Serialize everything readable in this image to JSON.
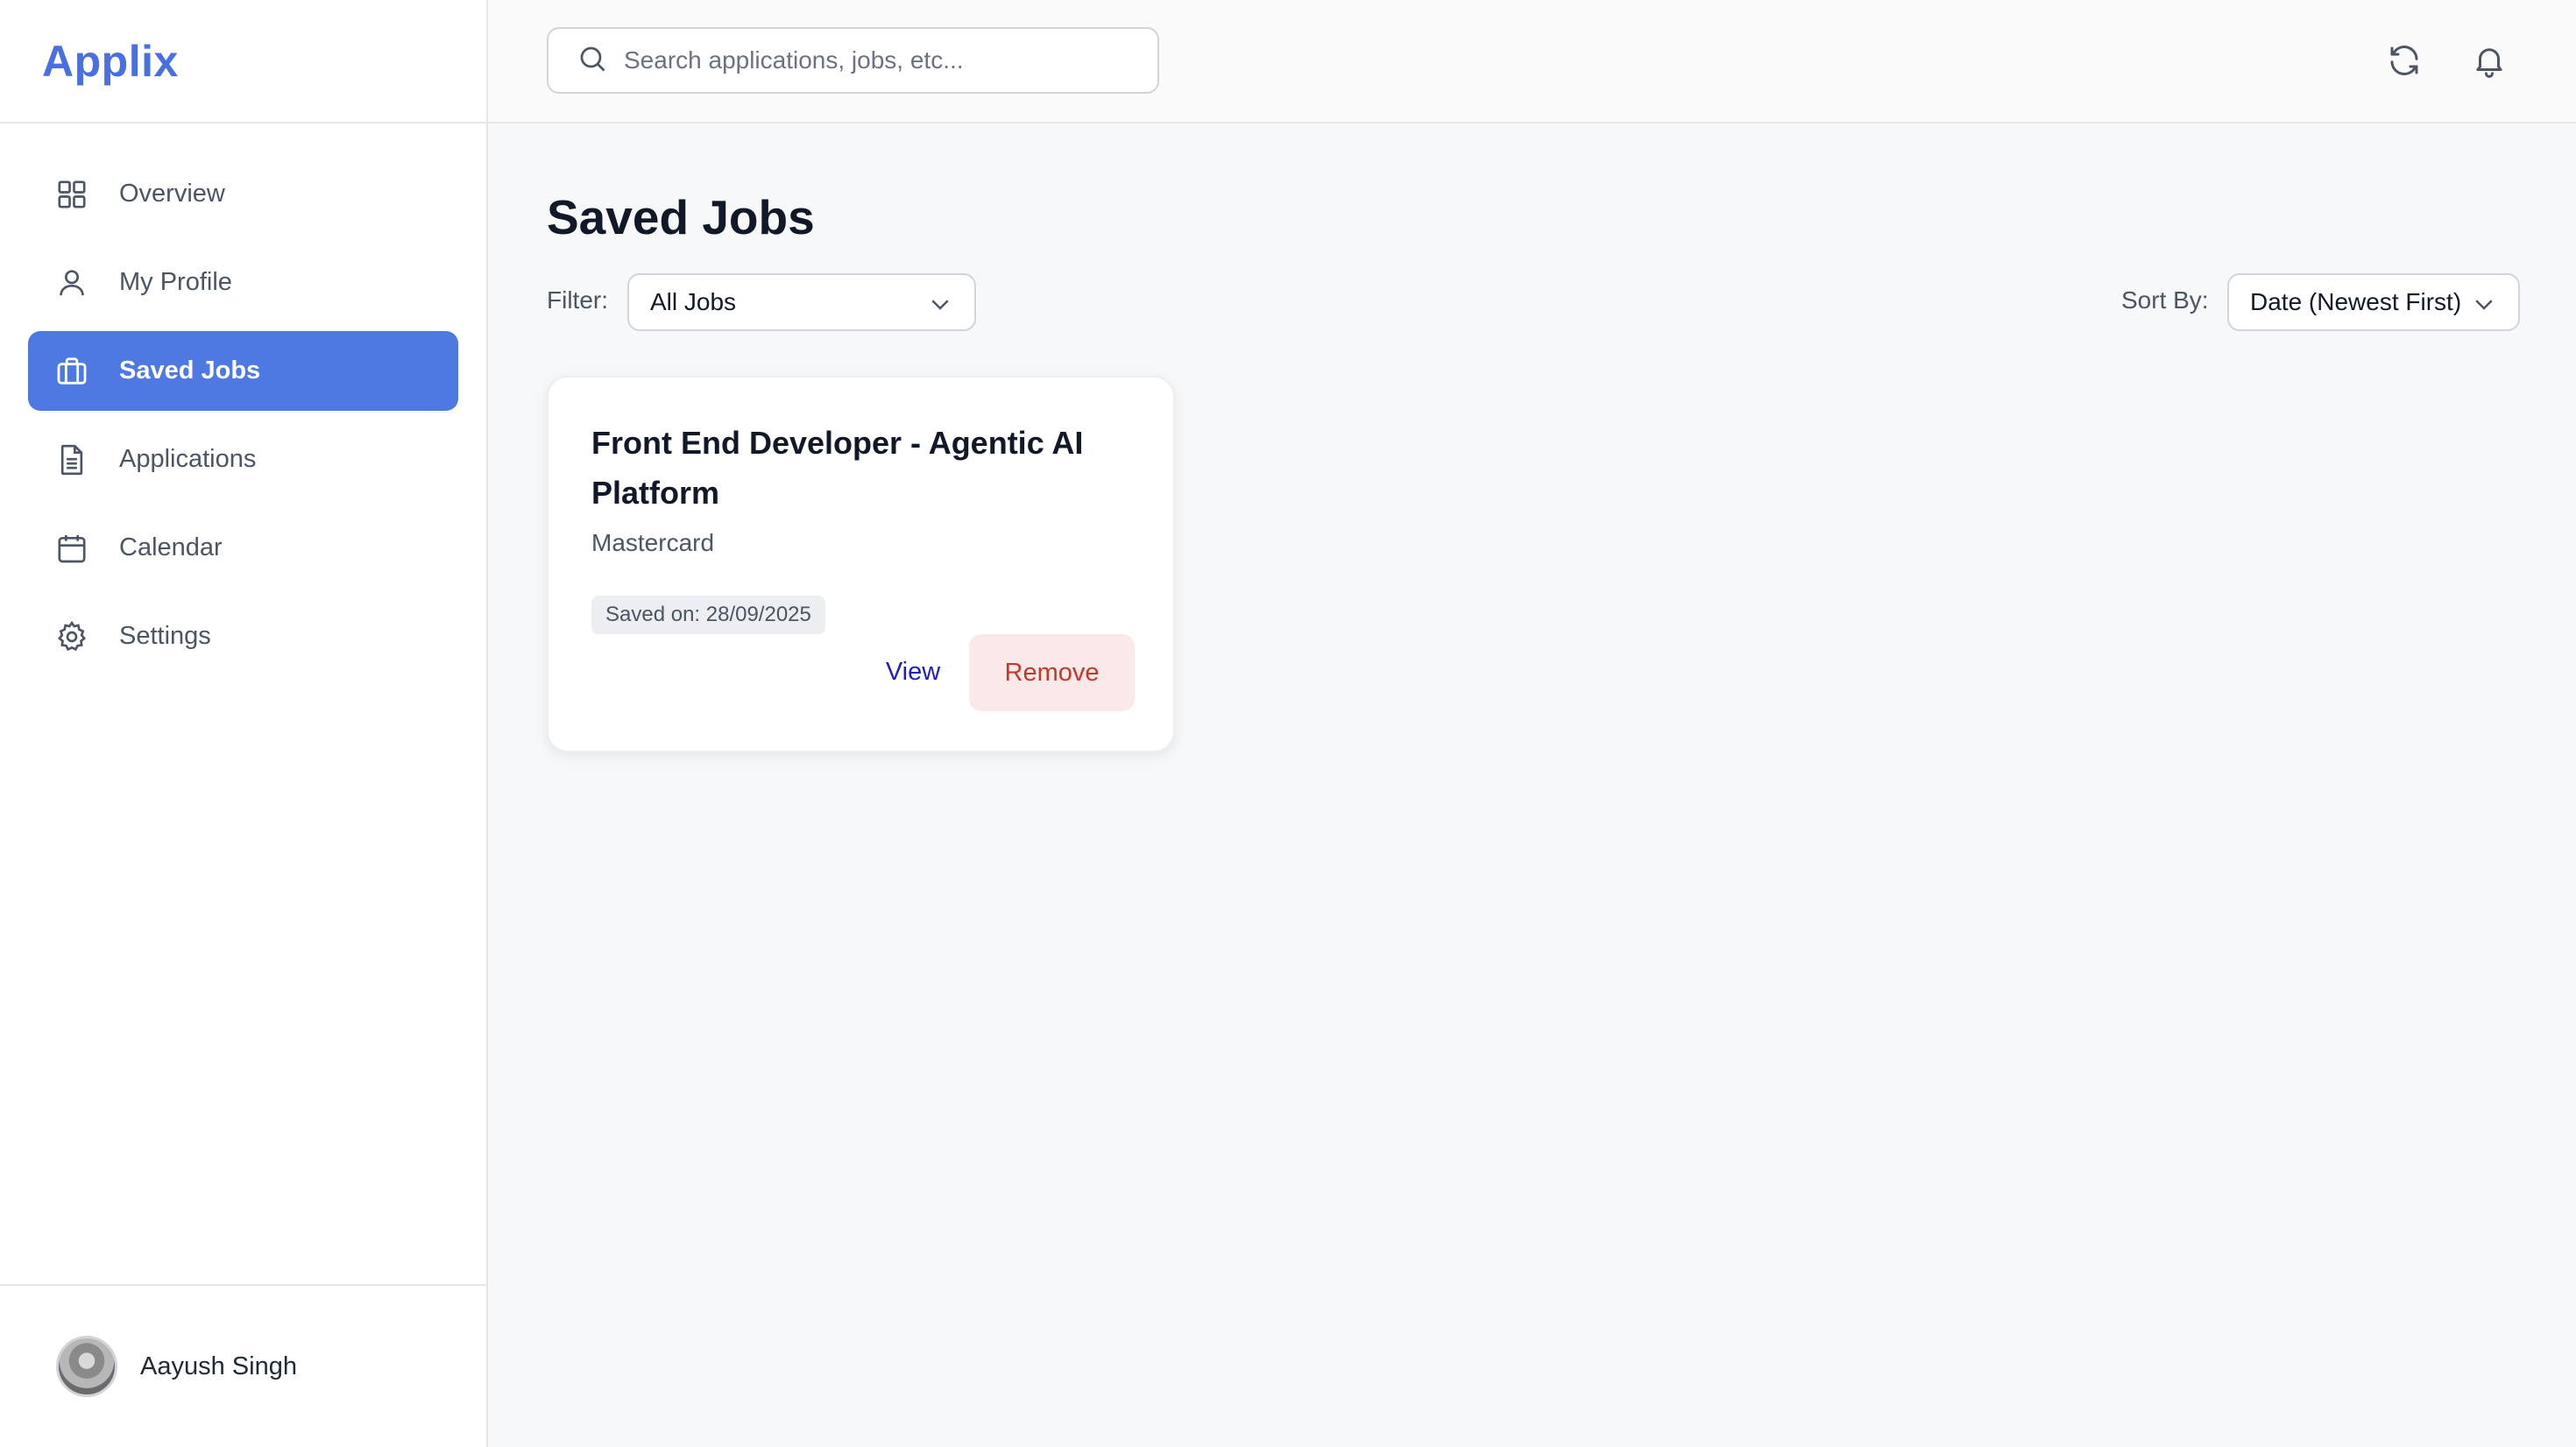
{
  "app": {
    "brand": "Applix"
  },
  "sidebar": {
    "items": [
      {
        "label": "Overview",
        "icon": "grid-icon",
        "active": false
      },
      {
        "label": "My Profile",
        "icon": "user-icon",
        "active": false
      },
      {
        "label": "Saved Jobs",
        "icon": "briefcase-icon",
        "active": true
      },
      {
        "label": "Applications",
        "icon": "document-icon",
        "active": false
      },
      {
        "label": "Calendar",
        "icon": "calendar-icon",
        "active": false
      },
      {
        "label": "Settings",
        "icon": "gear-icon",
        "active": false
      }
    ],
    "user": {
      "name": "Aayush Singh"
    }
  },
  "topbar": {
    "search_placeholder": "Search applications, jobs, etc...",
    "icons": [
      "refresh-icon",
      "bell-icon"
    ]
  },
  "page": {
    "title": "Saved Jobs",
    "filter_label": "Filter:",
    "filter_value": "All Jobs",
    "sort_label": "Sort By:",
    "sort_value": "Date (Newest First)"
  },
  "jobs": [
    {
      "title": "Front End Developer - Agentic AI Platform",
      "company": "Mastercard",
      "saved_on": "Saved on: 28/09/2025",
      "view_label": "View",
      "remove_label": "Remove"
    }
  ],
  "colors": {
    "accent": "#4e79e2",
    "brand": "#4a6fe0",
    "danger": "#c0392b",
    "danger_bg": "#fbe9e9"
  }
}
